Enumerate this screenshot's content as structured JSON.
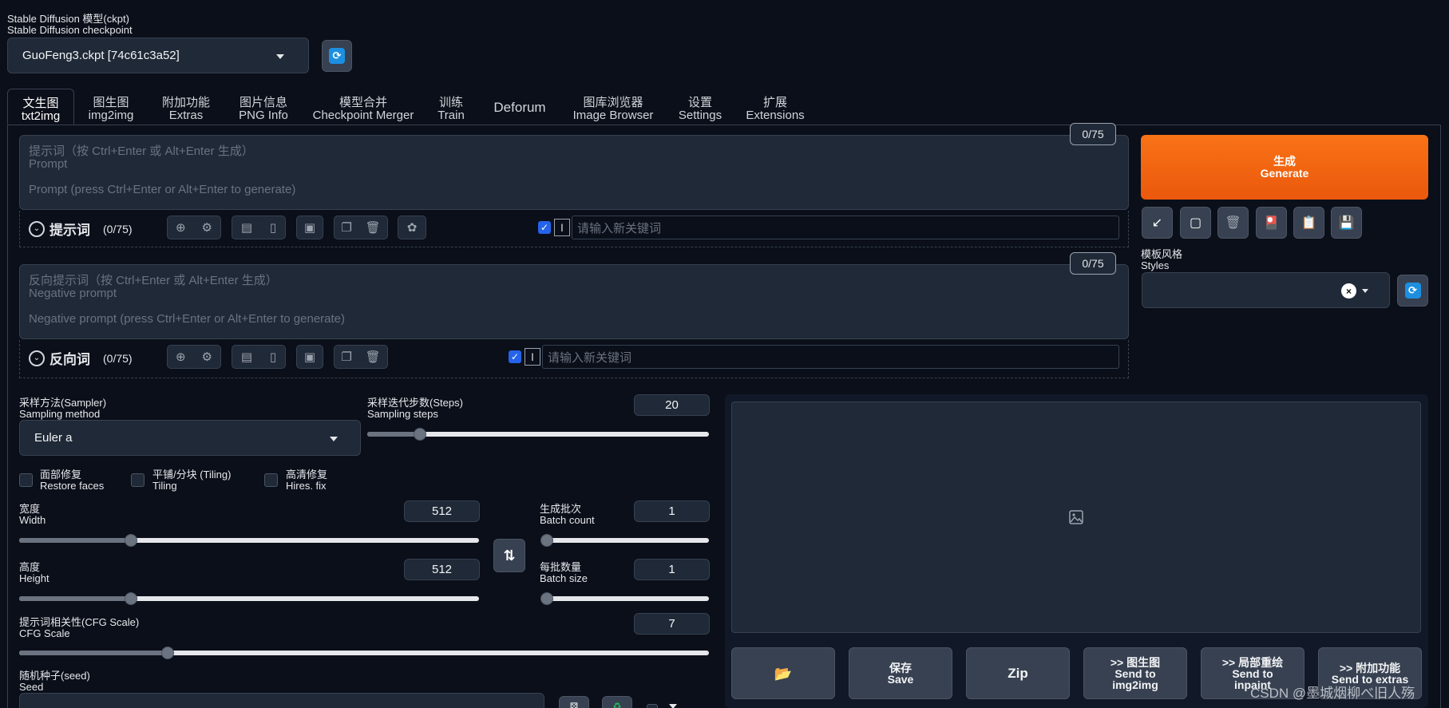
{
  "checkpoint": {
    "label_cn": "Stable Diffusion 模型(ckpt)",
    "label_en": "Stable Diffusion checkpoint",
    "value": "GuoFeng3.ckpt [74c61c3a52]"
  },
  "tabs": [
    {
      "cn": "文生图",
      "en": "txt2img"
    },
    {
      "cn": "图生图",
      "en": "img2img"
    },
    {
      "cn": "附加功能",
      "en": "Extras"
    },
    {
      "cn": "图片信息",
      "en": "PNG Info"
    },
    {
      "cn": "模型合并",
      "en": "Checkpoint Merger"
    },
    {
      "cn": "训练",
      "en": "Train"
    },
    {
      "cn": "Deforum",
      "en": ""
    },
    {
      "cn": "图库浏览器",
      "en": "Image Browser"
    },
    {
      "cn": "设置",
      "en": "Settings"
    },
    {
      "cn": "扩展",
      "en": "Extensions"
    }
  ],
  "prompt": {
    "counter": "0/75",
    "placeholder_cn": "提示词（按 Ctrl+Enter 或 Alt+Enter 生成）",
    "placeholder_en": "Prompt",
    "placeholder_hint": "Prompt (press Ctrl+Enter or Alt+Enter to generate)",
    "section_label": "提示词",
    "section_count": "(0/75)",
    "keyword_placeholder": "请输入新关键词"
  },
  "negative": {
    "counter": "0/75",
    "placeholder_cn": "反向提示词（按 Ctrl+Enter 或 Alt+Enter 生成）",
    "placeholder_en": "Negative prompt",
    "placeholder_hint": "Negative prompt (press Ctrl+Enter or Alt+Enter to generate)",
    "section_label": "反向词",
    "section_count": "(0/75)",
    "keyword_placeholder": "请输入新关键词"
  },
  "generate": {
    "cn": "生成",
    "en": "Generate"
  },
  "styles": {
    "cn": "模板风格",
    "en": "Styles"
  },
  "sampler": {
    "cn": "采样方法(Sampler)",
    "en": "Sampling method",
    "value": "Euler a"
  },
  "steps": {
    "cn": "采样迭代步数(Steps)",
    "en": "Sampling steps",
    "value": "20",
    "fraction": 0.14
  },
  "checkboxes": [
    {
      "cn": "面部修复",
      "en": "Restore faces"
    },
    {
      "cn": "平铺/分块 (Tiling)",
      "en": "Tiling"
    },
    {
      "cn": "高清修复",
      "en": "Hires. fix"
    }
  ],
  "width": {
    "cn": "宽度",
    "en": "Width",
    "value": "512",
    "fraction": 0.235
  },
  "height": {
    "cn": "高度",
    "en": "Height",
    "value": "512",
    "fraction": 0.235
  },
  "batch_count": {
    "cn": "生成批次",
    "en": "Batch count",
    "value": "1",
    "fraction": 0.0
  },
  "batch_size": {
    "cn": "每批数量",
    "en": "Batch size",
    "value": "1",
    "fraction": 0.0
  },
  "cfg": {
    "cn": "提示词相关性(CFG Scale)",
    "en": "CFG Scale",
    "value": "7",
    "fraction": 0.21
  },
  "seed": {
    "cn": "随机种子(seed)",
    "en": "Seed"
  },
  "actions": [
    {
      "line1": "",
      "line2": "",
      "icon": "folder-icon"
    },
    {
      "line1": "保存",
      "line2": "Save"
    },
    {
      "line1": "Zip",
      "line2": ""
    },
    {
      "line1": ">> 图生图",
      "line2": "Send to",
      "line3": "img2img"
    },
    {
      "line1": ">> 局部重绘",
      "line2": "Send to",
      "line3": "inpaint"
    },
    {
      "line1": ">> 附加功能",
      "line2": "Send to extras"
    }
  ],
  "watermark": "CSDN @墨城烟柳べ旧人殇"
}
